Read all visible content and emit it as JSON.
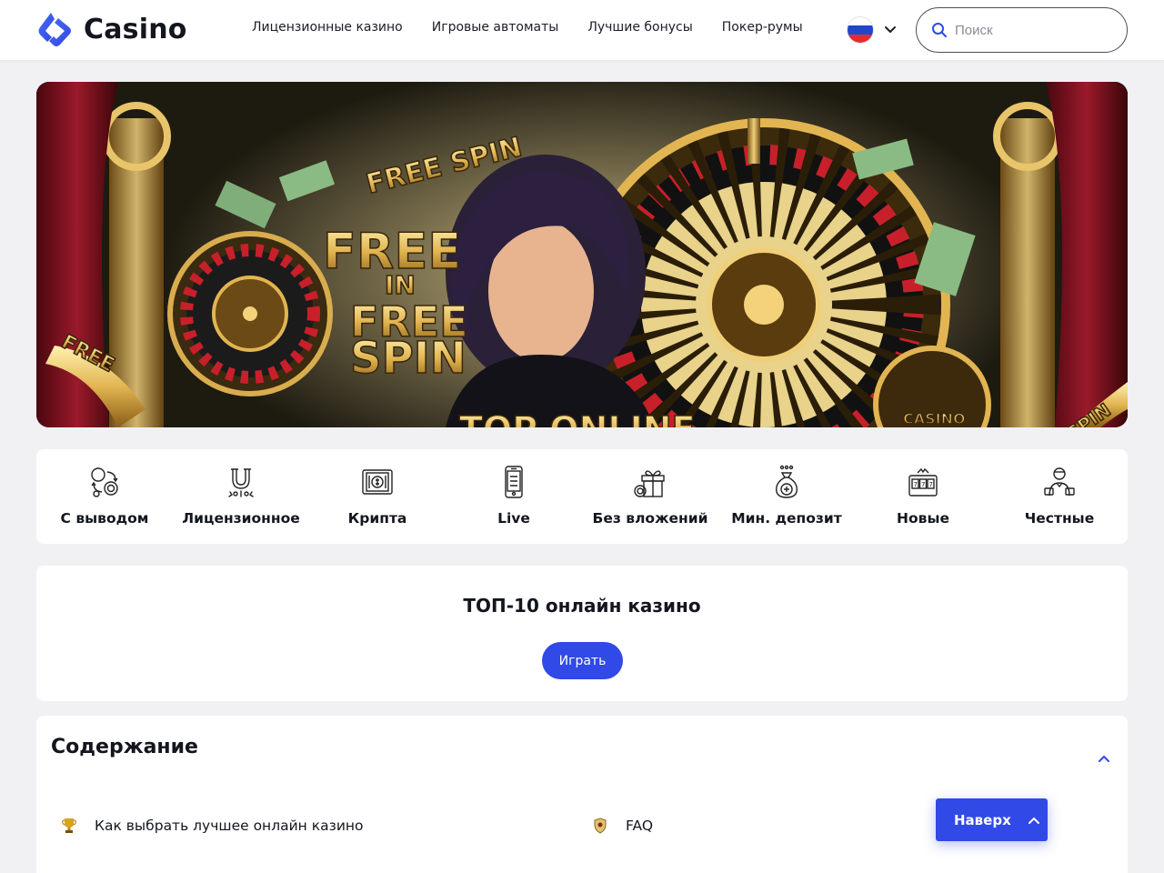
{
  "header": {
    "logo_text": "Casino",
    "nav": [
      {
        "label": "Лицензионные казино"
      },
      {
        "label": "Игровые автоматы"
      },
      {
        "label": "Лучшие бонусы"
      },
      {
        "label": "Покер-румы"
      }
    ],
    "language_flag": "russia-flag",
    "search_placeholder": "Поиск"
  },
  "banner": {
    "texts": [
      "FREE SPIN",
      "FREE",
      "IN",
      "FREE",
      "SPIN",
      "TOP ONLINE",
      "FREE",
      "CASINO",
      "SPIN"
    ]
  },
  "categories": [
    {
      "label": "С выводом",
      "icon": "coins-exchange-icon"
    },
    {
      "label": "Лицензионное",
      "icon": "horseshoe-icon"
    },
    {
      "label": "Крипта",
      "icon": "cash-icon"
    },
    {
      "label": "Live",
      "icon": "mobile-phone-icon"
    },
    {
      "label": "Без вложений",
      "icon": "gift-icon"
    },
    {
      "label": "Мин. депозит",
      "icon": "money-bag-icon"
    },
    {
      "label": "Новые",
      "icon": "slot-machine-icon"
    },
    {
      "label": "Честные",
      "icon": "dealer-icon"
    }
  ],
  "top10": {
    "title": "ТОП-10 онлайн казино",
    "button": "Играть"
  },
  "toc": {
    "title": "Содержание",
    "items": [
      {
        "label": "Как выбрать лучшее онлайн казино",
        "icon": "trophy-icon"
      },
      {
        "label": "FAQ",
        "icon": "shield-icon"
      }
    ]
  },
  "back_to_top": "Наверх",
  "colors": {
    "accent": "#3049e7",
    "text": "#14161f",
    "background": "#f1f1f4"
  }
}
